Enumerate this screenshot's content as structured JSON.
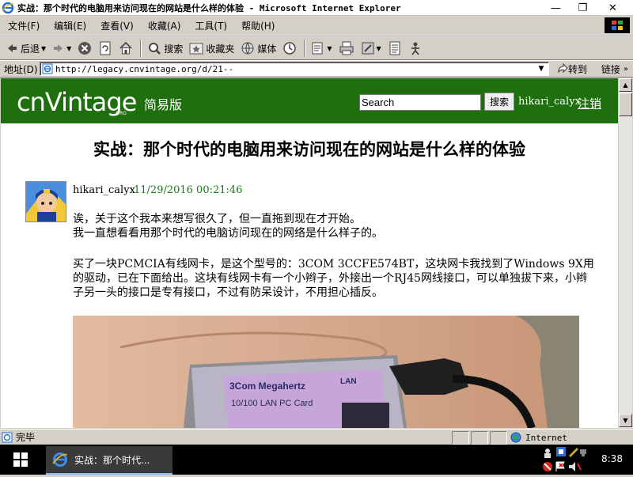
{
  "window": {
    "title": "实战：那个时代的电脑用来访问现在的网站是什么样的体验 - Microsoft Internet Explorer",
    "minimize_glyph": "—",
    "maximize_glyph": "❐",
    "close_glyph": "✕"
  },
  "menu": [
    "文件(F)",
    "编辑(E)",
    "查看(V)",
    "收藏(A)",
    "工具(T)",
    "帮助(H)"
  ],
  "toolbar": {
    "back_label": "后退",
    "search_label": "搜索",
    "favorites_label": "收藏夹",
    "media_label": "媒体"
  },
  "address": {
    "label": "地址(D)",
    "url": "http://legacy.cnvintage.org/d/21--",
    "go_label": "转到",
    "links_label": "链接"
  },
  "site": {
    "logo_text": "cnVintage",
    "logo_org": "ORG",
    "edition": "简易版",
    "search_value": "Search",
    "search_button": "搜索",
    "user": "hikari_calyx",
    "logout": "注销"
  },
  "article": {
    "title": "实战：那个时代的电脑用来访问现在的网站是什么样的体验",
    "author": "hikari_calyx",
    "date": "11/29/2016 00:21:46",
    "para1_line1": "诶，关于这个我本来想写很久了，但一直拖到现在才开始。",
    "para1_line2": "我一直想看看用那个时代的电脑访问现在的网络是什么样子的。",
    "para2": "买了一块PCMCIA有线网卡，是这个型号的：3COM 3CCFE574BT，这块网卡我找到了Windows 9X用的驱动，已在下面给出。这块有线网卡有一个小辫子，外接出一个RJ45网线接口，可以单独拔下来，小辫子另一头的接口是专有接口，不过有防呆设计，不用担心插反。",
    "photo_brand": "3Com Megahertz",
    "photo_lan": "LAN",
    "photo_model": "10/100 LAN PC Card"
  },
  "status": {
    "text": "完毕",
    "zone": "Internet"
  },
  "taskbar": {
    "item_label": "实战：那个时代...",
    "clock": "8:38"
  },
  "colors": {
    "site_header": "#1f6f0f",
    "date_green": "#1a7a1a"
  }
}
